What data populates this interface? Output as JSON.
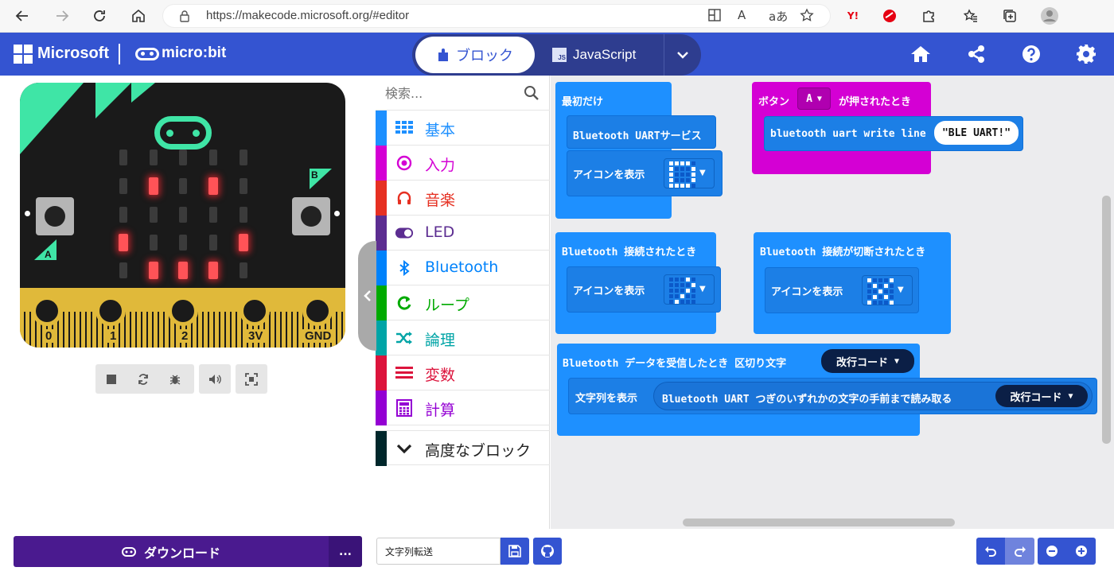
{
  "browser": {
    "url": "https://makecode.microsoft.org/#editor",
    "icons": [
      "back-icon",
      "forward-icon",
      "refresh-icon",
      "home-icon",
      "lock-icon",
      "reader-icon",
      "read-aloud-icon",
      "translate-icon",
      "favorite-icon",
      "yahoo-icon",
      "extension-icon",
      "puzzle-icon",
      "favorites-icon",
      "collections-icon",
      "profile-icon"
    ],
    "read_aloud": "A",
    "translate": "aあ",
    "yahoo": "Y!"
  },
  "header": {
    "microsoft_label": "Microsoft",
    "microbit_label": "micro:bit",
    "tab_blocks": "ブロック",
    "tab_js": "JavaScript",
    "js_badge": "JS",
    "icons": [
      "home-icon",
      "share-icon",
      "help-icon",
      "settings-icon"
    ],
    "colors": {
      "header_bg": "#3454d1",
      "switch_bg": "#2e3d8f"
    }
  },
  "simulator": {
    "pins": [
      "0",
      "1",
      "2",
      "3V",
      "GND"
    ],
    "button_a": "A",
    "button_b": "B",
    "led_on": [
      [
        1,
        1
      ],
      [
        3,
        1
      ],
      [
        0,
        3
      ],
      [
        4,
        3
      ],
      [
        1,
        4
      ],
      [
        2,
        4
      ],
      [
        3,
        4
      ]
    ],
    "toolbar_icons": [
      "stop-icon",
      "restart-icon",
      "debug-icon",
      "mute-icon",
      "fullscreen-icon"
    ]
  },
  "toolbox": {
    "search_placeholder": "検索...",
    "categories": [
      {
        "label": "基本",
        "color": "#1e90ff",
        "icon": "grid-icon"
      },
      {
        "label": "入力",
        "color": "#d400d4",
        "icon": "input-icon"
      },
      {
        "label": "音楽",
        "color": "#e63022",
        "icon": "headphones-icon"
      },
      {
        "label": "LED",
        "color": "#5c2d91",
        "icon": "toggle-icon"
      },
      {
        "label": "Bluetooth",
        "color": "#0082fb",
        "icon": "bluetooth-icon"
      },
      {
        "label": "ループ",
        "color": "#00aa00",
        "icon": "loop-icon"
      },
      {
        "label": "論理",
        "color": "#00a4a6",
        "icon": "shuffle-icon"
      },
      {
        "label": "変数",
        "color": "#dc143c",
        "icon": "list-icon"
      },
      {
        "label": "計算",
        "color": "#9400d3",
        "icon": "calculator-icon"
      },
      {
        "label": "高度なブロック",
        "color": "#00272b",
        "icon": "chevron-down-icon"
      }
    ]
  },
  "workspace": {
    "on_start": "最初だけ",
    "uart_service": "Bluetooth UARTサービス",
    "show_icon": "アイコンを表示",
    "button_pressed_prefix": "ボタン",
    "button_value": "A",
    "button_pressed_suffix": "が押されたとき",
    "uart_write_line": "bluetooth uart write line",
    "ble_text": "BLE UART!",
    "on_connected": "Bluetooth 接続されたとき",
    "on_disconnected": "Bluetooth 接続が切断されたとき",
    "on_data_received": "Bluetooth データを受信したとき 区切り文字",
    "newline": "改行コード",
    "show_string": "文字列を表示",
    "read_until": "Bluetooth UART つぎのいずれかの文字の手前まで読み取る",
    "icon_heart": [
      [
        0,
        0
      ],
      [
        0,
        1
      ],
      [
        0,
        2
      ],
      [
        0,
        3
      ],
      [
        0,
        4
      ],
      [
        1,
        0
      ],
      [
        1,
        4
      ],
      [
        2,
        0
      ],
      [
        2,
        4
      ],
      [
        3,
        0
      ],
      [
        3,
        4
      ],
      [
        4,
        1
      ],
      [
        4,
        2
      ],
      [
        4,
        3
      ]
    ],
    "icon_yes": [
      [
        1,
        4
      ],
      [
        2,
        3
      ],
      [
        3,
        0
      ],
      [
        3,
        2
      ],
      [
        4,
        1
      ]
    ],
    "icon_no": [
      [
        0,
        0
      ],
      [
        0,
        4
      ],
      [
        1,
        1
      ],
      [
        1,
        3
      ],
      [
        2,
        2
      ],
      [
        3,
        1
      ],
      [
        3,
        3
      ],
      [
        4,
        0
      ],
      [
        4,
        4
      ]
    ]
  },
  "bottombar": {
    "download": "ダウンロード",
    "more": "...",
    "project_name": "文字列転送",
    "icons": [
      "save-icon",
      "github-icon",
      "undo-icon",
      "redo-icon",
      "zoom-out-icon",
      "zoom-in-icon"
    ]
  }
}
